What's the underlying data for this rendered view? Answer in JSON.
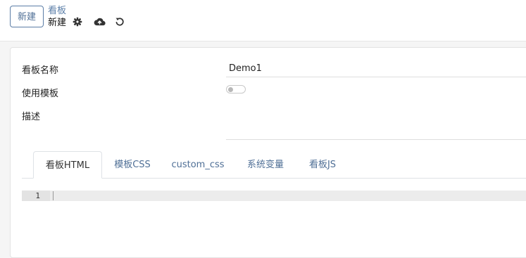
{
  "toolbar": {
    "new_label": "新建",
    "breadcrumb_link": "看板",
    "breadcrumb_current": "新建",
    "icons": [
      "gear-icon",
      "cloud-upload-icon",
      "undo-icon"
    ]
  },
  "form": {
    "name_label": "看板名称",
    "name_value": "Demo1",
    "template_label": "使用模板",
    "template_enabled": false,
    "desc_label": "描述",
    "desc_value": ""
  },
  "tabs": [
    {
      "label": "看板HTML",
      "active": true
    },
    {
      "label": "模板CSS",
      "active": false
    },
    {
      "label": "custom_css",
      "active": false
    },
    {
      "label": "系统变量",
      "active": false
    },
    {
      "label": "看板JS",
      "active": false
    }
  ],
  "editor": {
    "line_number": "1",
    "content": ""
  },
  "colors": {
    "accent": "#4f6f96",
    "link": "#5a7ea8"
  }
}
